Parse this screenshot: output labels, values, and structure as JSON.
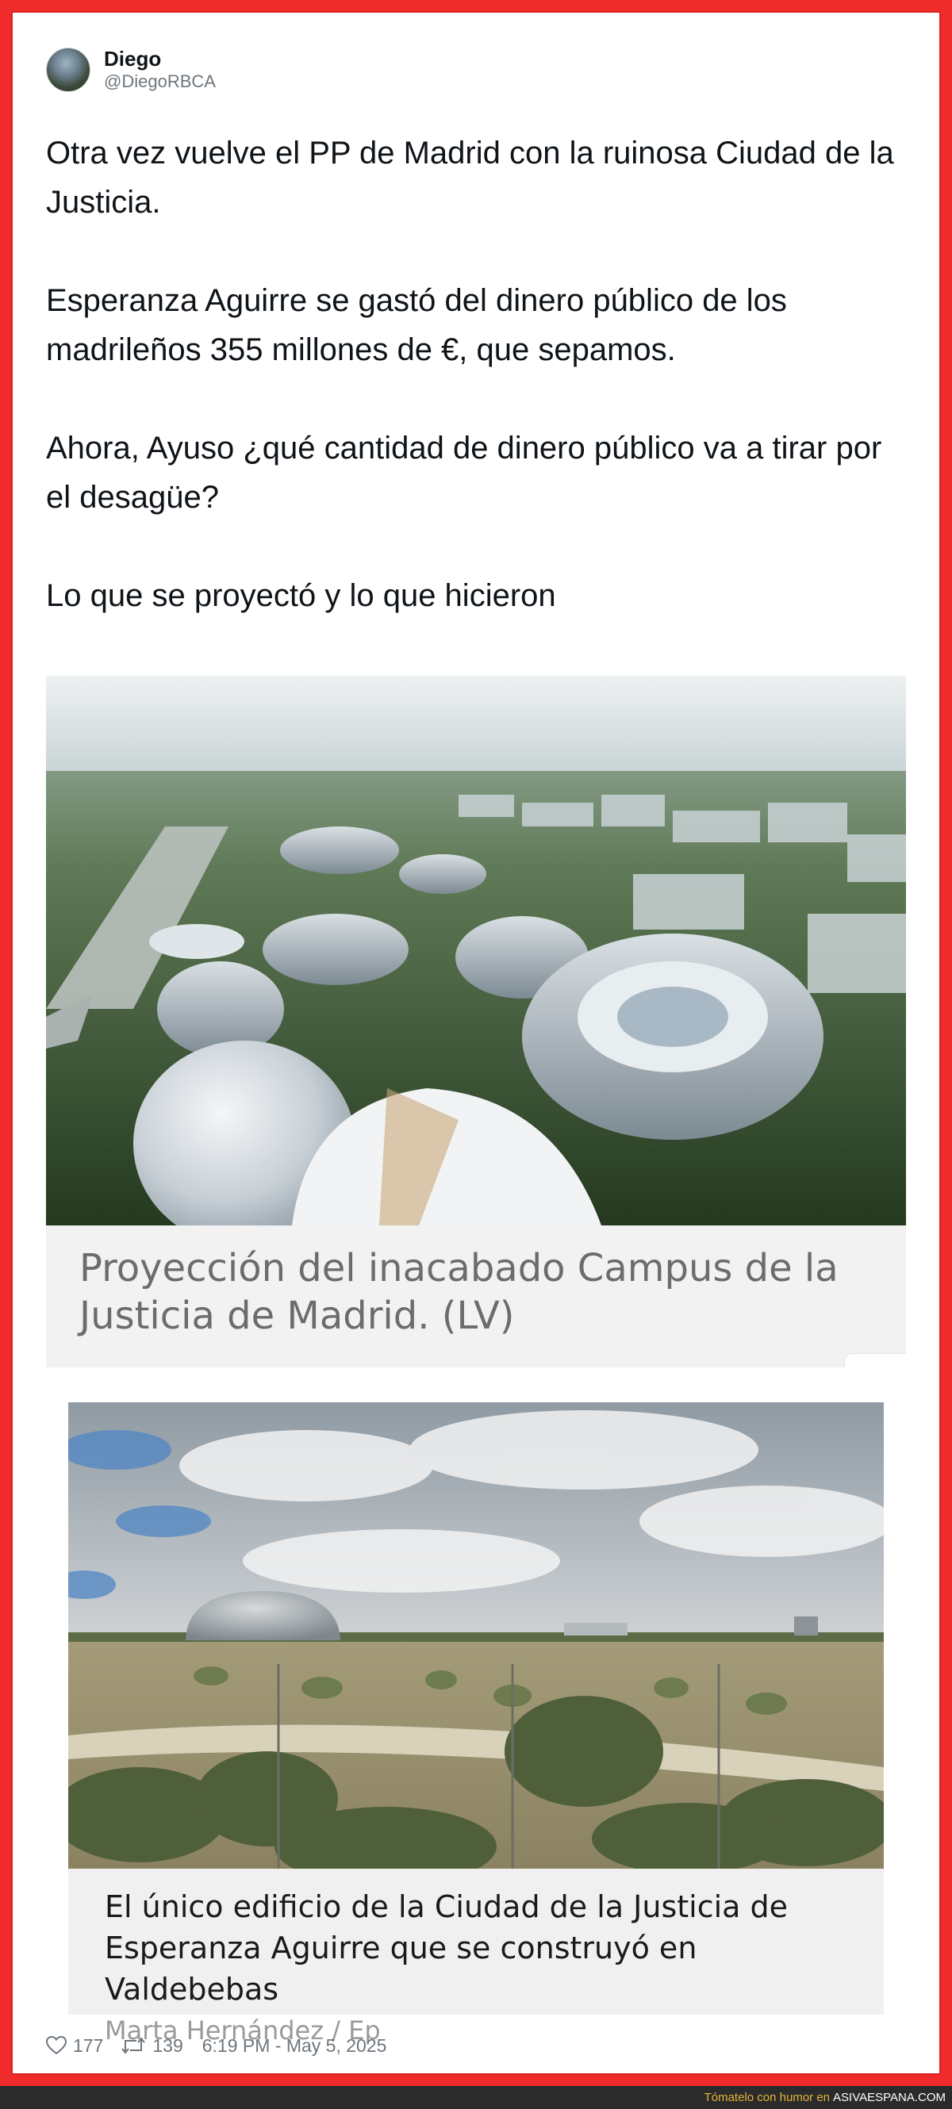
{
  "author": {
    "name": "Diego",
    "handle": "@DiegoRBCA"
  },
  "tweet": {
    "paragraphs": [
      "Otra vez vuelve el PP de Madrid con la ruinosa Ciudad de la Justicia.",
      "Esperanza Aguirre se gastó del dinero público de los madrileños 355 millones de €, que sepamos.",
      "Ahora, Ayuso ¿qué cantidad de dinero público va a tirar por el desagüe?",
      "Lo que se proyectó y lo que hicieron"
    ]
  },
  "media": [
    {
      "caption": "Proyección del inacabado Campus de la Justicia de Madrid. (LV)"
    },
    {
      "caption": "El único edificio de la Ciudad de la Justicia de Esperanza Aguirre que se construyó en Valdebebas",
      "credit": "Marta Hernández / Ep"
    }
  ],
  "stats": {
    "likes": "177",
    "retweets": "139",
    "timestamp": "6:19 PM - May 5, 2025"
  },
  "icons": {
    "like": "heart-icon",
    "retweet": "retweet-icon"
  },
  "watermark": {
    "text": "Tómatelo con humor en",
    "site": "ASIVAESPANA.COM"
  },
  "colors": {
    "frame": "#ef2b2b",
    "watermark_accent": "#e2b43a"
  }
}
